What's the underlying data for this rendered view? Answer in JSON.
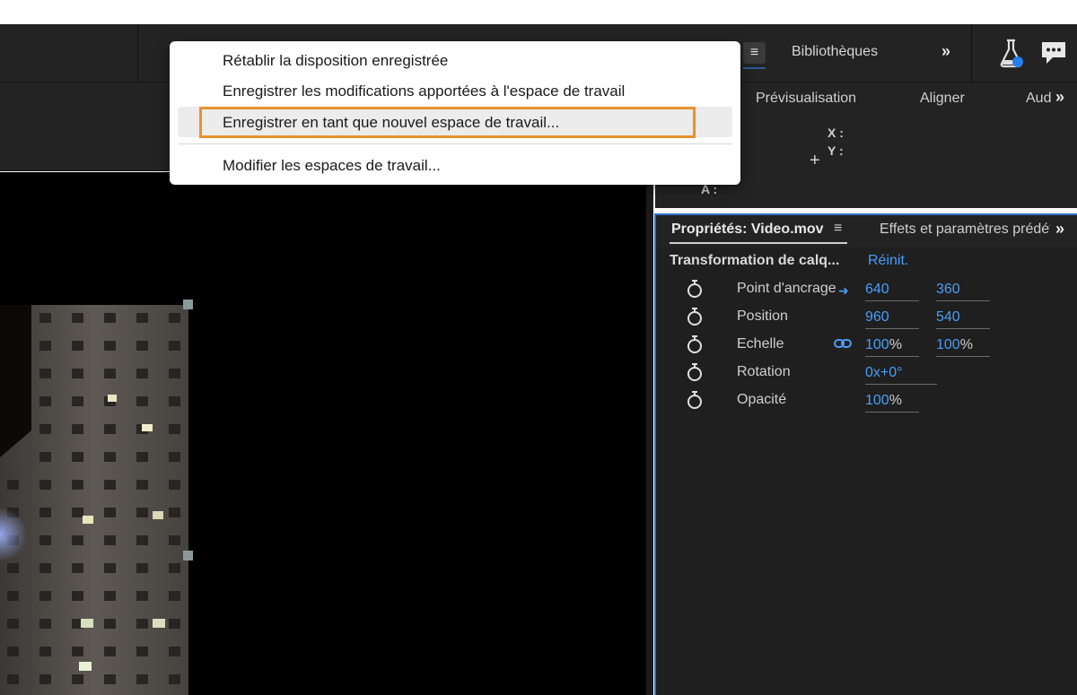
{
  "toolbar": {
    "libraries_label": "Bibliothèques",
    "overflow_glyph": "»"
  },
  "panel_tabs": {
    "preview": "Prévisualisation",
    "align": "Aligner",
    "audio": "Audio",
    "overflow_glyph": "»"
  },
  "info": {
    "x_label": "X :",
    "y_label": "Y :",
    "a_label": "A :"
  },
  "properties": {
    "title": "Propriétés: Video.mov",
    "effects_tab": "Effets et paramètres prédéfinis",
    "section": "Transformation de calq...",
    "reset": "Réinit.",
    "rows": [
      {
        "label": "Point d'ancrage",
        "v1": "640",
        "v2": "360"
      },
      {
        "label": "Position",
        "v1": "960",
        "v2": "540"
      },
      {
        "label": "Echelle",
        "v1": "100",
        "u1": "%",
        "v2": "100",
        "u2": "%"
      },
      {
        "label": "Rotation",
        "v1": "0x+0°"
      },
      {
        "label": "Opacité",
        "v1": "100",
        "u1": "%"
      }
    ]
  },
  "menu": {
    "items": [
      "Rétablir la disposition enregistrée",
      "Enregistrer les modifications apportées à l'espace de travail",
      "Enregistrer en tant que nouvel espace de travail...",
      "Modifier les espaces de travail..."
    ],
    "highlight_color": "#e8922c"
  },
  "colors": {
    "accent_blue": "#4a9df8",
    "panel_border": "#2d6fc7",
    "flask_dot": "#2680eb"
  },
  "icons": [
    "hamburger-menu-icon",
    "flask-icon",
    "chat-icon",
    "stopwatch-icon",
    "link-icon",
    "double-chevron-icon",
    "crosshair-icon"
  ]
}
